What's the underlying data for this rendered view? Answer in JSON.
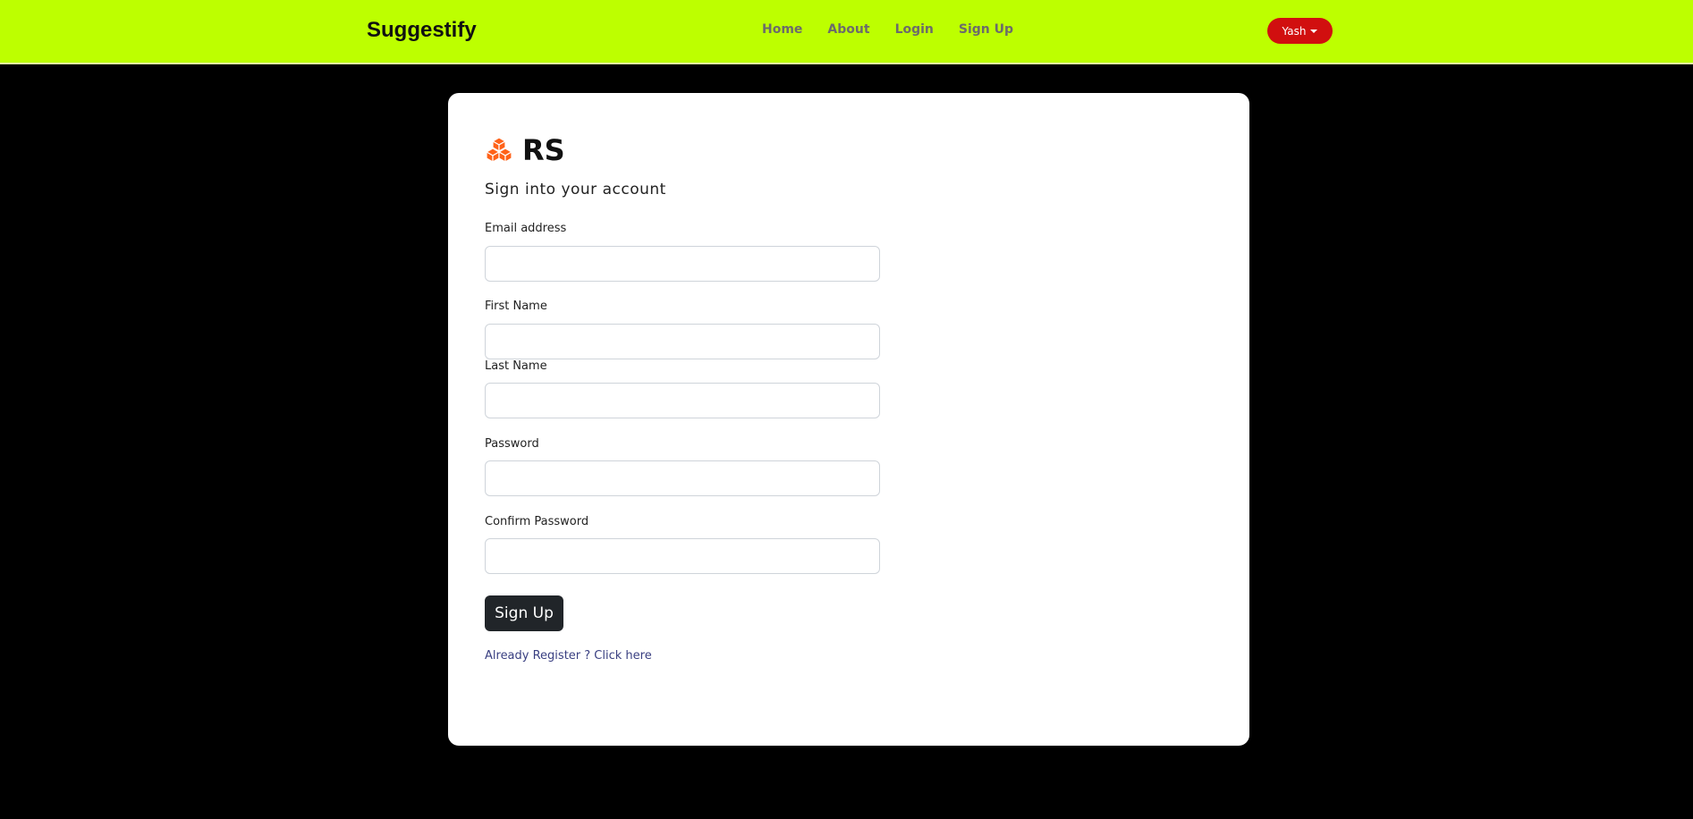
{
  "navbar": {
    "brand": "Suggestify",
    "links": [
      "Home",
      "About",
      "Login",
      "Sign Up"
    ],
    "user_button": "Yash",
    "background": "#bdff00",
    "user_button_color": "#d10f0f"
  },
  "card": {
    "logo_icon": "cubes-icon",
    "logo_text": "RS",
    "subtitle": "Sign into your account",
    "fields": [
      {
        "label": "Email address",
        "value": "",
        "type": "email"
      },
      {
        "label": "First Name",
        "value": "",
        "type": "text"
      },
      {
        "label": "Last Name",
        "value": "",
        "type": "text"
      },
      {
        "label": "Password",
        "value": "",
        "type": "password"
      },
      {
        "label": "Confirm Password",
        "value": "",
        "type": "password"
      }
    ],
    "submit_label": "Sign Up",
    "login_link": "Already Register ? Click here",
    "accent_color": "#ff6219"
  }
}
